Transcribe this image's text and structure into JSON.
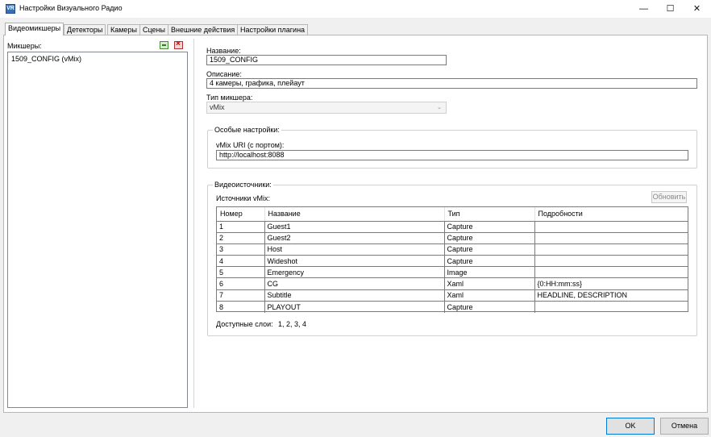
{
  "window": {
    "icon_label": "VR",
    "title": "Настройки Визуального Радио",
    "minimize": "—",
    "maximize": "☐",
    "close": "✕"
  },
  "tabs": [
    {
      "label": "Видеомикшеры",
      "active": true
    },
    {
      "label": "Детекторы"
    },
    {
      "label": "Камеры"
    },
    {
      "label": "Сцены"
    },
    {
      "label": "Внешние действия"
    },
    {
      "label": "Настройки плагина"
    }
  ],
  "mixers": {
    "label": "Микшеры:",
    "items": [
      "1509_CONFIG (vMix)"
    ]
  },
  "form": {
    "name_label": "Название:",
    "name_value": "1509_CONFIG",
    "description_label": "Описание:",
    "description_value": "4 камеры, графика, плейаут",
    "mixer_type_label": "Тип микшера:",
    "mixer_type_value": "vMix",
    "combo_arrow": "⌄"
  },
  "special": {
    "title": "Особые настройки:",
    "uri_label": "vMix URI (с портом):",
    "uri_value": "http://localhost:8088"
  },
  "video_sources": {
    "title": "Видеоисточники:",
    "sources_label": "Источники vMix:",
    "refresh_label": "Обновить",
    "columns": [
      "Номер",
      "Название",
      "Тип",
      "Подробности"
    ],
    "rows": [
      [
        "1",
        "Guest1",
        "Capture",
        ""
      ],
      [
        "2",
        "Guest2",
        "Capture",
        ""
      ],
      [
        "3",
        "Host",
        "Capture",
        ""
      ],
      [
        "4",
        "Wideshot",
        "Capture",
        ""
      ],
      [
        "5",
        "Emergency",
        "Image",
        ""
      ],
      [
        "6",
        "CG",
        "Xaml",
        "{0:HH:mm:ss}"
      ],
      [
        "7",
        "Subtitle",
        "Xaml",
        "HEADLINE, DESCRIPTION"
      ],
      [
        "8",
        "PLAYOUT",
        "Capture",
        ""
      ]
    ],
    "layers_label": "Доступные слои:",
    "layers_value": "1, 2, 3, 4"
  },
  "footer": {
    "ok": "OK",
    "cancel": "Отмена"
  }
}
